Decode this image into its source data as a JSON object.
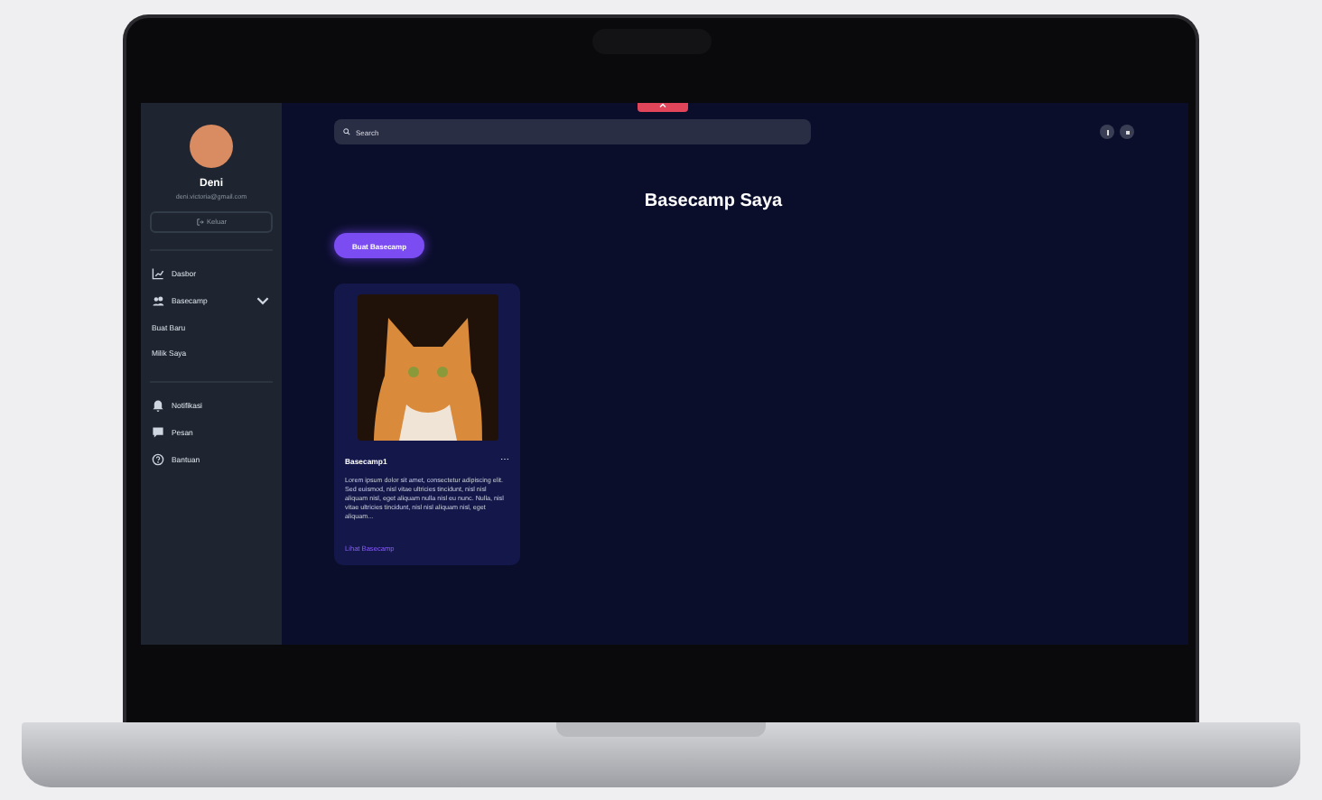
{
  "sidebar": {
    "user": {
      "name": "Deni",
      "email": "deni.victoria@gmail.com"
    },
    "logout_button": "Keluar",
    "menu": [
      {
        "kind": "link",
        "label": "Dasbor"
      },
      {
        "kind": "group",
        "label": "Basecamp",
        "expanded": true,
        "children": [
          {
            "label": "Buat Baru"
          },
          {
            "label": "Milik Saya"
          }
        ]
      },
      {
        "kind": "divider"
      },
      {
        "kind": "link",
        "label": "Notifikasi"
      },
      {
        "kind": "link",
        "label": "Pesan"
      },
      {
        "kind": "link",
        "label": "Bantuan"
      }
    ]
  },
  "search": {
    "placeholder": "Search"
  },
  "page_title": "Basecamp Saya",
  "create_button": "Buat Basecamp",
  "cards": [
    {
      "title": "Basecamp1",
      "menu": "⋯",
      "description": "Lorem ipsum dolor sit amet, consectetur adipiscing elit. Sed euismod, nisl vitae ultricies tincidunt, nisl nisl aliquam nisl, eget aliquam nulla nisl eu nunc. Nulla, nisl vitae ultricies tincidunt, nisl nisl aliquam nisl, eget aliquam...",
      "link": "Lihat Basecamp"
    }
  ]
}
